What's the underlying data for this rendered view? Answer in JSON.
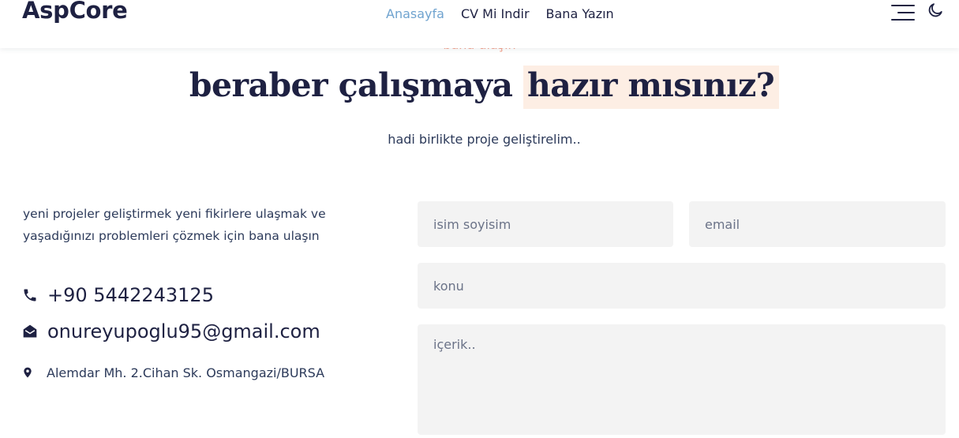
{
  "header": {
    "logo": "AspCore",
    "nav": [
      {
        "label": "Anasayfa",
        "active": true
      },
      {
        "label": "CV Mi Indir",
        "active": false
      },
      {
        "label": "Bana Yazın",
        "active": false
      }
    ],
    "icons": {
      "menu": "hamburger-menu-icon",
      "theme": "moon-icon"
    }
  },
  "section": {
    "eyebrow": "bana ulaşın",
    "headline_plain": "beraber çalışmaya ",
    "headline_highlight": "hazır mısınız?",
    "subline": "hadi birlikte proje geliştirelim.."
  },
  "contact": {
    "intro": "yeni projeler geliştirmek yeni fikirlere ulaşmak ve yaşadığınızı problemleri çözmek için bana ulaşın",
    "phone": "+90 5442243125",
    "email": "onureyupoglu95@gmail.com",
    "address": "Alemdar Mh. 2.Cihan Sk. Osmangazi/BURSA"
  },
  "form": {
    "name_placeholder": "isim soyisim",
    "email_placeholder": "email",
    "subject_placeholder": "konu",
    "message_placeholder": "içerik.."
  },
  "colors": {
    "navy": "#1e2142",
    "accent_blue": "#6fa3cf",
    "eyebrow_salmon": "#f2a08a",
    "highlight_bg": "#fdeee4",
    "field_bg": "#f3f3f3"
  }
}
